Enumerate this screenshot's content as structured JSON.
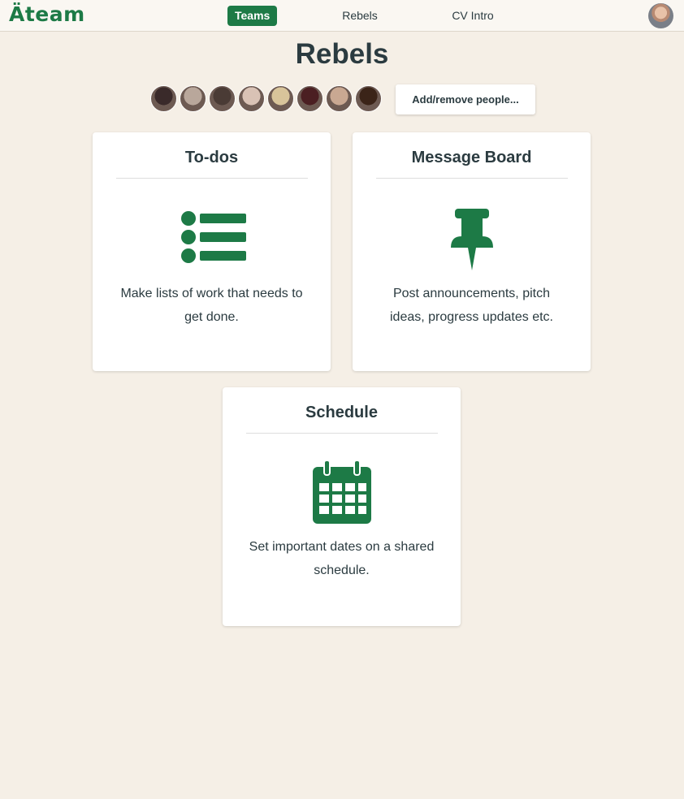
{
  "app": {
    "logo": "Äteam"
  },
  "nav": {
    "items": [
      {
        "label": "Teams",
        "active": true
      },
      {
        "label": "Rebels",
        "active": false
      },
      {
        "label": "CV Intro",
        "active": false
      }
    ]
  },
  "page": {
    "title": "Rebels"
  },
  "people": {
    "add_button_label": "Add/remove people...",
    "avatars": [
      {
        "color": "#3a2a2a"
      },
      {
        "color": "#b9a79b"
      },
      {
        "color": "#4a3b35"
      },
      {
        "color": "#d9c2b5"
      },
      {
        "color": "#d8c49a"
      },
      {
        "color": "#4b1f22"
      },
      {
        "color": "#c9a892"
      },
      {
        "color": "#3b2418"
      }
    ]
  },
  "tools": [
    {
      "title": "To-dos",
      "icon": "list-icon",
      "description": "Make lists of work that needs to get done."
    },
    {
      "title": "Message Board",
      "icon": "pushpin-icon",
      "description": "Post announcements, pitch ideas, progress updates etc."
    },
    {
      "title": "Schedule",
      "icon": "calendar-icon",
      "description": "Set important dates on a shared schedule."
    }
  ],
  "colors": {
    "accent": "#1d7a46",
    "background": "#f5efe6",
    "text": "#2b3b40"
  }
}
